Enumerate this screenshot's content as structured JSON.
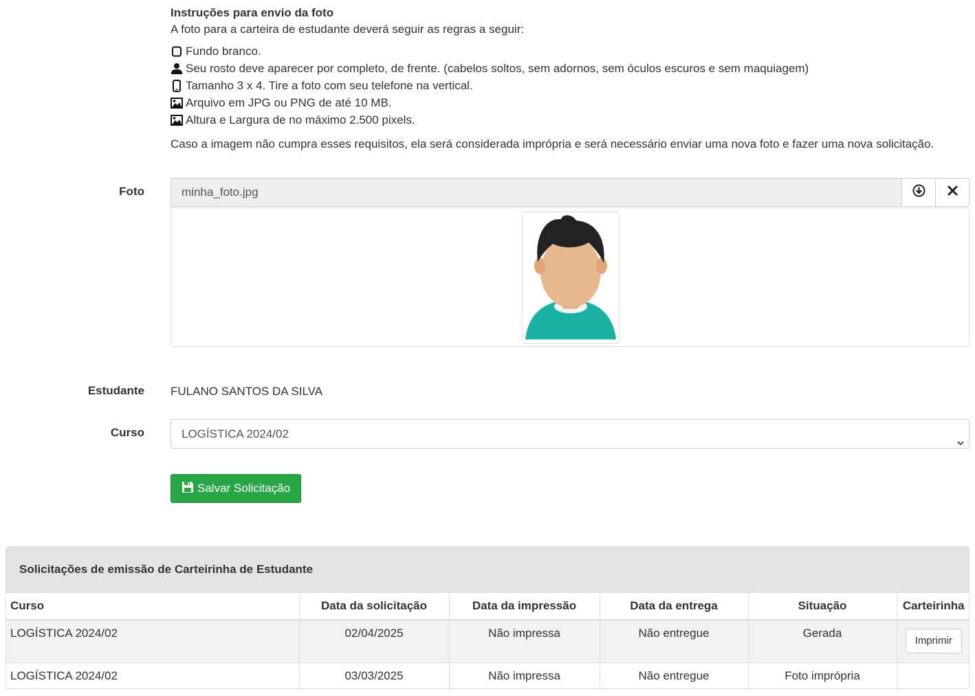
{
  "instructions": {
    "title": "Instruções para envio da foto",
    "intro": "A foto para a carteira de estudante deverá seguir as regras a seguir:",
    "rules": [
      {
        "icon": "square-icon",
        "text": "Fundo branco."
      },
      {
        "icon": "user-icon",
        "text": "Seu rosto deve aparecer por completo, de frente. (cabelos soltos, sem adornos, sem óculos escuros e sem maquiagem)"
      },
      {
        "icon": "mobile-phone-icon",
        "text": "Tamanho 3 x 4. Tire a foto com seu telefone na vertical."
      },
      {
        "icon": "image-icon",
        "text": "Arquivo em JPG ou PNG de até 10 MB."
      },
      {
        "icon": "image-icon",
        "text": "Altura e Largura de no máximo 2.500 pixels."
      }
    ],
    "note": "Caso a imagem não cumpra esses requisitos, ela será considerada imprópria e será necessário enviar uma nova foto e fazer uma nova solicitação."
  },
  "form": {
    "photo_label": "Foto",
    "photo_filename": "minha_foto.jpg",
    "student_label": "Estudante",
    "student_name": "FULANO SANTOS DA SILVA",
    "course_label": "Curso",
    "course_selected": "LOGÍSTICA 2024/02",
    "save_label": "Salvar Solicitação"
  },
  "requests": {
    "title": "Solicitações de emissão de Carteirinha de Estudante",
    "columns": [
      "Curso",
      "Data da solicitação",
      "Data da impressão",
      "Data da entrega",
      "Situação",
      "Carteirinha"
    ],
    "rows": [
      {
        "curso": "LOGÍSTICA 2024/02",
        "solicitacao": "02/04/2025",
        "impressao": "Não impressa",
        "entrega": "Não entregue",
        "situacao": "Gerada",
        "action": "Imprimir"
      },
      {
        "curso": "LOGÍSTICA 2024/02",
        "solicitacao": "03/03/2025",
        "impressao": "Não impressa",
        "entrega": "Não entregue",
        "situacao": "Foto imprópria",
        "action": ""
      }
    ]
  },
  "colors": {
    "success": "#28a745",
    "avatar_shirt": "#1ab3a3",
    "avatar_skin": "#e8b88f",
    "avatar_hair": "#222222"
  }
}
